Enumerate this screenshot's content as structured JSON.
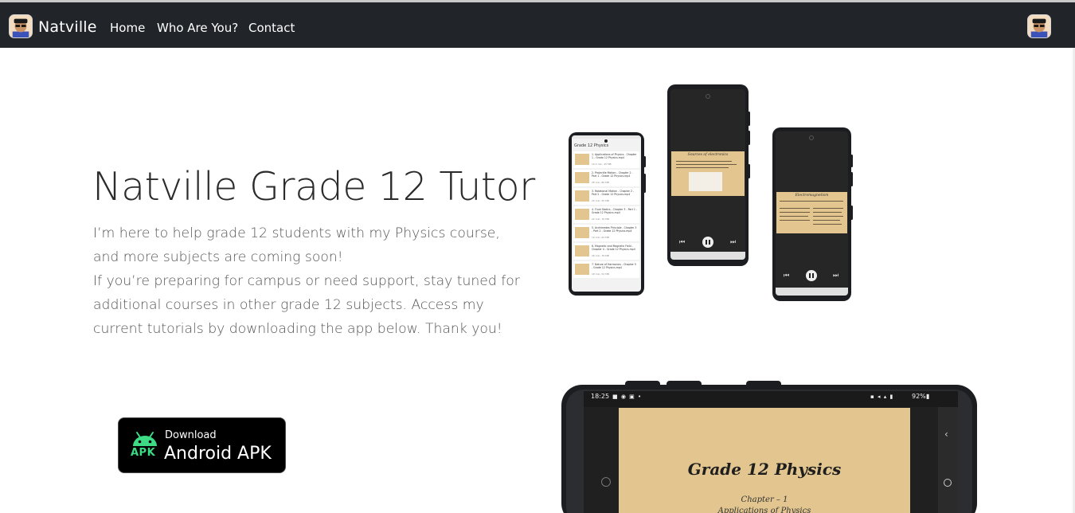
{
  "nav": {
    "brand": "Natville",
    "links": [
      "Home",
      "Who Are You?",
      "Contact"
    ]
  },
  "hero": {
    "title": "Natville Grade 12 Tutor",
    "paragraph1": "I’m here to help grade 12 students with my Physics course, and more subjects are coming soon!",
    "paragraph2": "If you’re preparing for campus or need support, stay tuned for additional courses in other grade 12 subjects. Access my current tutorials by downloading the app below. Thank you!"
  },
  "download": {
    "small": "Download",
    "big": "Android APK",
    "badge": "APK"
  },
  "mockups": {
    "list_title": "Grade 12 Physics",
    "list_items": [
      {
        "title": "1. Applications of Physics - Chapter 1 - Grade 12 Physics.mp4",
        "meta": "10.4 min, 45 MB"
      },
      {
        "title": "2. Projectile Motion - Chapter 2 - Part 1 - Grade 12 Physics.mp4",
        "meta": "28 min, 80 MB"
      },
      {
        "title": "3. Rotational Motion - Chapter 2 - Part 2 - Grade 12 Physics.mp4",
        "meta": "20 min, 55 MB"
      },
      {
        "title": "4. Fluid Statics - Chapter 3 - Part 1 - Grade 12 Physics.mp4",
        "meta": "22 min, 70 MB"
      },
      {
        "title": "5. Archimedes Principle - Chapter 3 - Part 2 - Grade 12 Physics.mp4",
        "meta": "19 min, 62 MB"
      },
      {
        "title": "6. Magnetic and Magnetic Field - Chapter 4 - Grade 12 Physics.mp4",
        "meta": "26 min, 78 MB"
      },
      {
        "title": "7. Nature of Harmonics - Chapter 5 - Grade 12 Physics.mp4",
        "meta": "18 min, 52 MB"
      }
    ],
    "video2_title": "Sources of electronics",
    "video3_title": "Electromagnetism",
    "big_screen": {
      "time": "18:25",
      "battery": "92%",
      "title": "Grade 12 Physics",
      "chapter": "Chapter – 1",
      "subtitle": "Applications of Physics"
    }
  },
  "colors": {
    "navbar": "#212529",
    "android_green": "#3ddc84",
    "paper": "#e2c58f"
  }
}
